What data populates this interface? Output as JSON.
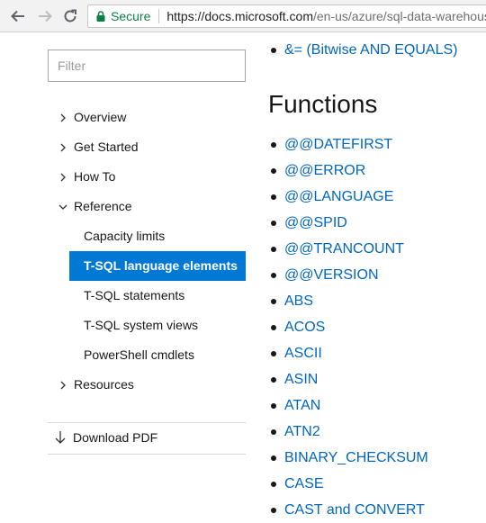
{
  "browser": {
    "back_icon": "arrow-left-icon",
    "forward_icon": "arrow-right-icon",
    "reload_icon": "reload-icon",
    "security_label": "Secure",
    "url_scheme": "https://",
    "url_host": "docs.microsoft.com",
    "url_path": "/en-us/azure/sql-data-warehouse"
  },
  "sidebar": {
    "filter_placeholder": "Filter",
    "items": [
      {
        "label": "Overview",
        "level": 0,
        "state": "collapsed"
      },
      {
        "label": "Get Started",
        "level": 0,
        "state": "collapsed"
      },
      {
        "label": "How To",
        "level": 0,
        "state": "collapsed"
      },
      {
        "label": "Reference",
        "level": 0,
        "state": "expanded"
      },
      {
        "label": "Capacity limits",
        "level": 1
      },
      {
        "label": "T-SQL language elements",
        "level": 1,
        "active": true
      },
      {
        "label": "T-SQL statements",
        "level": 1
      },
      {
        "label": "T-SQL system views",
        "level": 1
      },
      {
        "label": "PowerShell cmdlets",
        "level": 1
      },
      {
        "label": "Resources",
        "level": 0,
        "state": "collapsed"
      }
    ],
    "download_label": "Download PDF",
    "download_icon": "download-arrow-icon"
  },
  "main": {
    "top_items": [
      "&= (Bitwise AND EQUALS)"
    ],
    "heading": "Functions",
    "functions": [
      "@@DATEFIRST",
      "@@ERROR",
      "@@LANGUAGE",
      "@@SPID",
      "@@TRANCOUNT",
      "@@VERSION",
      "ABS",
      "ACOS",
      "ASCII",
      "ASIN",
      "ATAN",
      "ATN2",
      "BINARY_CHECKSUM",
      "CASE",
      "CAST and CONVERT"
    ]
  },
  "colors": {
    "link": "#0066c0",
    "active_bg": "#0078d4",
    "secure_green": "#0b8043"
  }
}
